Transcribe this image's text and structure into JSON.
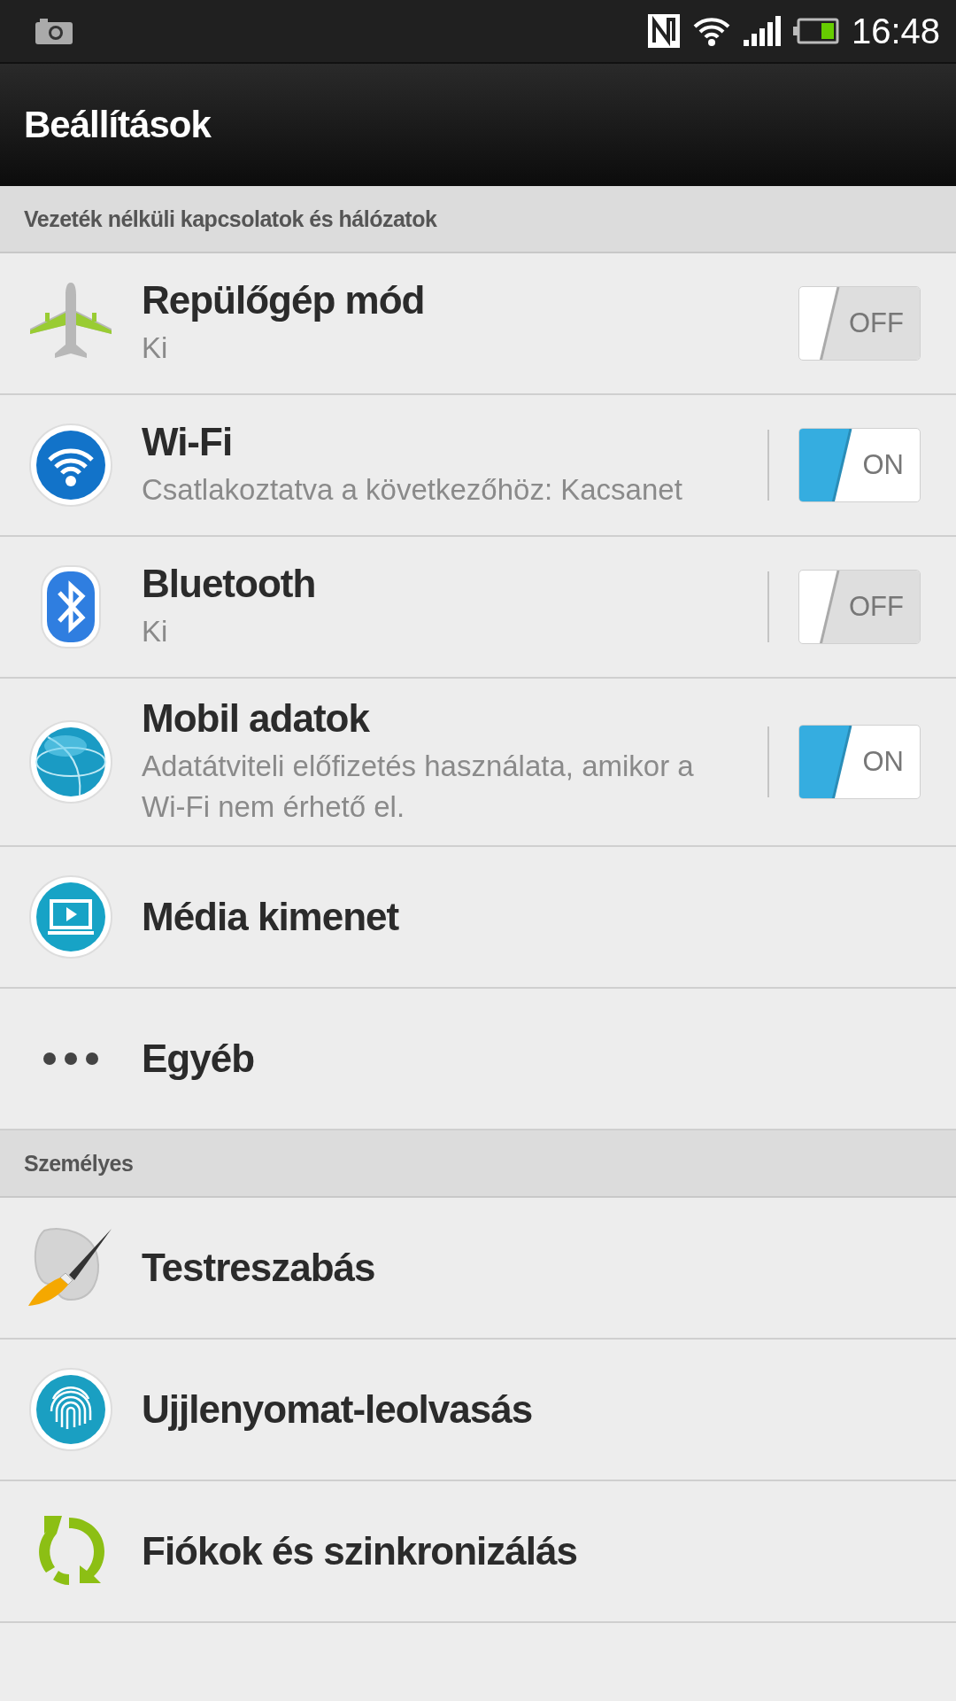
{
  "status_bar": {
    "time": "16:48"
  },
  "title_bar": {
    "title": "Beállítások"
  },
  "sections": [
    {
      "header": "Vezeték nélküli kapcsolatok és hálózatok",
      "items": [
        {
          "kind": "switch",
          "title": "Repülőgép mód",
          "subtitle": "Ki",
          "on": false,
          "switch_label": "OFF"
        },
        {
          "kind": "split_switch",
          "title": "Wi-Fi",
          "subtitle": "Csatlakoztatva a következőhöz: Kacsanet",
          "on": true,
          "switch_label": "ON"
        },
        {
          "kind": "split_switch",
          "title": "Bluetooth",
          "subtitle": "Ki",
          "on": false,
          "switch_label": "OFF"
        },
        {
          "kind": "split_switch",
          "title": "Mobil adatok",
          "subtitle": "Adatátviteli előfizetés használata, amikor a Wi-Fi nem érhető el.",
          "on": true,
          "switch_label": "ON"
        },
        {
          "kind": "link",
          "title": "Média kimenet"
        },
        {
          "kind": "link",
          "title": "Egyéb"
        }
      ]
    },
    {
      "header": "Személyes",
      "items": [
        {
          "kind": "link",
          "title": "Testreszabás"
        },
        {
          "kind": "link",
          "title": "Ujjlenyomat-leolvasás"
        },
        {
          "kind": "link",
          "title": "Fiókok és szinkronizálás"
        }
      ]
    }
  ]
}
